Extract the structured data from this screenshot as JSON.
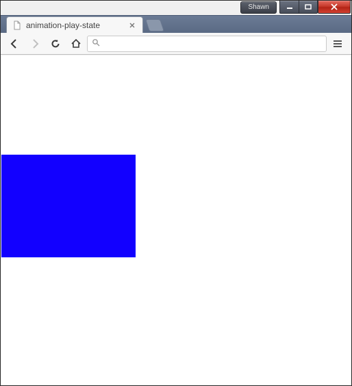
{
  "window": {
    "profile_label": "Shawn"
  },
  "tab": {
    "title": "animation-play-state"
  },
  "omnibox": {
    "value": "",
    "placeholder": ""
  },
  "content": {
    "box_color": "#1200ff"
  }
}
